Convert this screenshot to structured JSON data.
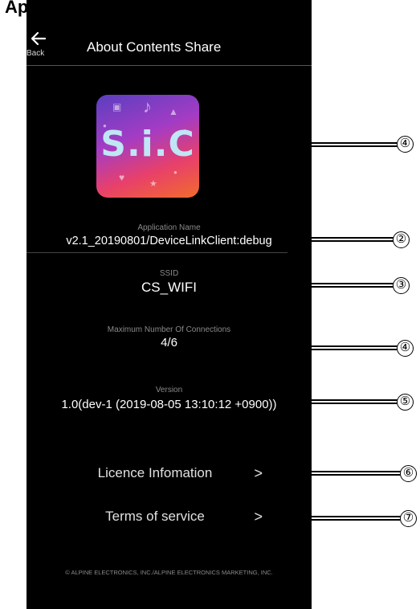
{
  "page_label": "App",
  "header": {
    "back_label": "Back",
    "title": "About Contents Share"
  },
  "app_icon": {
    "logo_text": "S.i.C"
  },
  "info": {
    "app_name_label": "Application Name",
    "app_name_value": "v2.1_20190801/DeviceLinkClient:debug",
    "ssid_label": "SSID",
    "ssid_value": "CS_WIFI",
    "max_conn_label": "Maximum Number Of Connections",
    "max_conn_value": "4/6",
    "version_label": "Version",
    "version_value": "1.0(dev-1 (2019-08-05 13:10:12 +0900))"
  },
  "links": {
    "licence_label": "Licence Infomation",
    "terms_label": "Terms of service",
    "chevron": ">"
  },
  "footer": {
    "copyright": "© ALPINE ELECTRONICS, INC./ALPINE ELECTRONICS MARKETING, INC."
  },
  "callouts": [
    "④",
    "②",
    "③",
    "④",
    "⑤",
    "⑥",
    "⑦"
  ]
}
